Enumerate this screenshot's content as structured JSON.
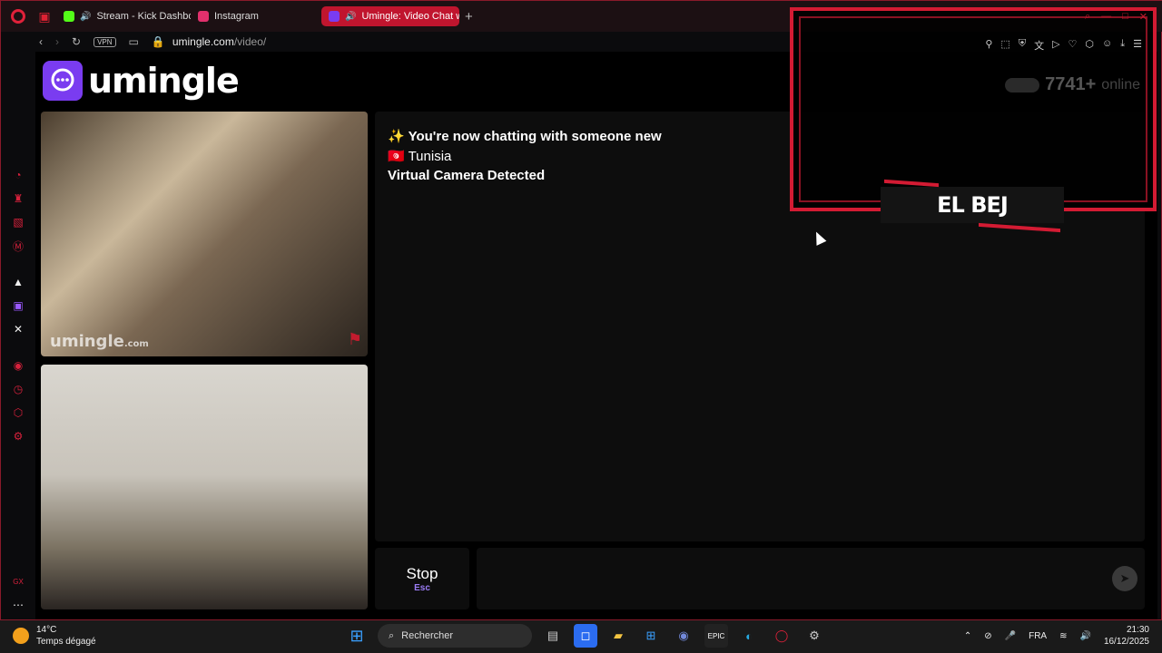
{
  "browser": {
    "tabs": [
      {
        "label": "Stream - Kick Dashbo",
        "color": "#53fc18",
        "active": false
      },
      {
        "label": "Instagram",
        "color": "#e1306c",
        "active": false
      },
      {
        "label": "Umingle: Video Chat w",
        "color": "#7a3cf0",
        "active": true
      }
    ],
    "new_tab": "+",
    "vpn_label": "VPN",
    "url_host": "umingle.com",
    "url_path": "/video/"
  },
  "site": {
    "logo_text": "umingle",
    "watermark": "umingle",
    "watermark_suffix": ".com"
  },
  "chat": {
    "line1": "✨ You're now chatting with someone new",
    "line2": "🇹🇳 Tunisia",
    "line3": "Virtual Camera Detected"
  },
  "controls": {
    "stop_label": "Stop",
    "stop_key": "Esc",
    "send_icon": "send-icon"
  },
  "overlay": {
    "online_count": "7741+",
    "online_label": "online",
    "nameplate": "EL BEJ"
  },
  "taskbar": {
    "temperature": "14°C",
    "weather": "Temps dégagé",
    "search_placeholder": "Rechercher",
    "language": "FRA",
    "time": "21:30",
    "date": "16/12/2025"
  }
}
